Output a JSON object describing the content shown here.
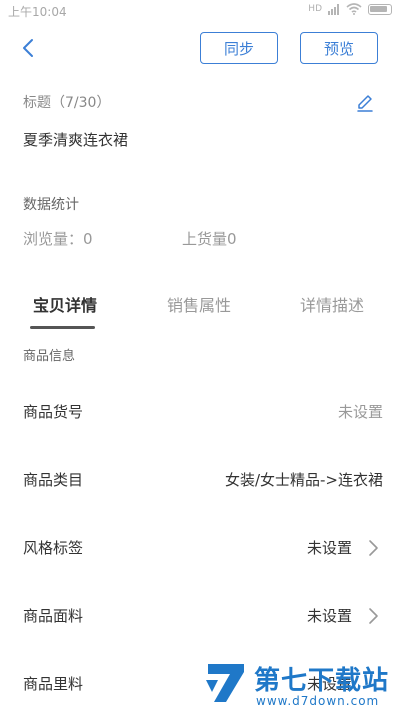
{
  "status_bar": {
    "time": "上午10:04",
    "signal_text": "HD"
  },
  "topbar": {
    "sync_label": "同步",
    "preview_label": "预览"
  },
  "title_section": {
    "label": "标题（7/30）",
    "value": "夏季清爽连衣裙"
  },
  "stats": {
    "heading": "数据统计",
    "views": "浏览量：0",
    "listings": "上货量0"
  },
  "tabs": [
    {
      "label": "宝贝详情",
      "active": true
    },
    {
      "label": "销售属性",
      "active": false
    },
    {
      "label": "详情描述",
      "active": false
    }
  ],
  "product_info": {
    "section_title": "商品信息",
    "rows": [
      {
        "label": "商品货号",
        "value": "未设置"
      },
      {
        "label": "商品类目",
        "value": "女装/女士精品->连衣裙"
      },
      {
        "label": "风格标签",
        "value": "未设置"
      },
      {
        "label": "商品面料",
        "value": "未设置"
      },
      {
        "label": "商品里料",
        "value": "未设置"
      }
    ]
  },
  "watermark": {
    "text": "第七下载站",
    "url": "www.d7down.com"
  },
  "colors": {
    "accent": "#3c7fd6",
    "watermark": "#1f78c8"
  },
  "icons": {
    "back": "chevron-left-icon",
    "edit": "pencil-icon",
    "row_arrow": "chevron-right-icon"
  }
}
